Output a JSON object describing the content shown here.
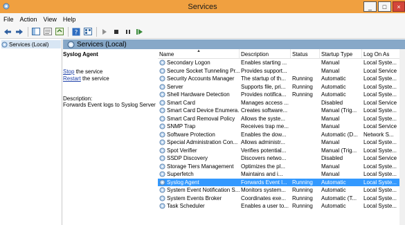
{
  "window": {
    "title": "Services",
    "minimize_label": "_",
    "maximize_label": "□",
    "close_label": "×"
  },
  "menu": [
    "File",
    "Action",
    "View",
    "Help"
  ],
  "toolbar_icons": [
    "back-icon",
    "forward-icon",
    "show-hide-tree-icon",
    "properties-icon",
    "refresh-icon",
    "help-icon",
    "view-icon",
    "start-icon",
    "stop-icon",
    "pause-icon",
    "restart-icon"
  ],
  "tree": {
    "root_label": "Services (Local)"
  },
  "pane": {
    "header_label": "Services (Local)",
    "selected_service": "Syslog Agent",
    "stop_link": "Stop",
    "stop_suffix": " the service",
    "restart_link": "Restart",
    "restart_suffix": " the service",
    "description_label": "Description:",
    "description_text": "Forwards Event logs to Syslog Server"
  },
  "table": {
    "columns": [
      "Name",
      "Description",
      "Status",
      "Startup Type",
      "Log On As"
    ],
    "rows": [
      {
        "name": "Secondary Logon",
        "description": "Enables starting ...",
        "status": "",
        "startup": "Manual",
        "logon": "Local Syste..."
      },
      {
        "name": "Secure Socket Tunneling Pr...",
        "description": "Provides support...",
        "status": "",
        "startup": "Manual",
        "logon": "Local Service"
      },
      {
        "name": "Security Accounts Manager",
        "description": "The startup of th...",
        "status": "Running",
        "startup": "Automatic",
        "logon": "Local Syste..."
      },
      {
        "name": "Server",
        "description": "Supports file, pri...",
        "status": "Running",
        "startup": "Automatic",
        "logon": "Local Syste..."
      },
      {
        "name": "Shell Hardware Detection",
        "description": "Provides notifica...",
        "status": "Running",
        "startup": "Automatic",
        "logon": "Local Syste..."
      },
      {
        "name": "Smart Card",
        "description": "Manages access ...",
        "status": "",
        "startup": "Disabled",
        "logon": "Local Service"
      },
      {
        "name": "Smart Card Device Enumera...",
        "description": "Creates software...",
        "status": "",
        "startup": "Manual (Trig...",
        "logon": "Local Syste..."
      },
      {
        "name": "Smart Card Removal Policy",
        "description": "Allows the syste...",
        "status": "",
        "startup": "Manual",
        "logon": "Local Syste..."
      },
      {
        "name": "SNMP Trap",
        "description": "Receives trap me...",
        "status": "",
        "startup": "Manual",
        "logon": "Local Service"
      },
      {
        "name": "Software Protection",
        "description": "Enables the dow...",
        "status": "",
        "startup": "Automatic (D...",
        "logon": "Network S..."
      },
      {
        "name": "Special Administration Con...",
        "description": "Allows administr...",
        "status": "",
        "startup": "Manual",
        "logon": "Local Syste..."
      },
      {
        "name": "Spot Verifier",
        "description": "Verifies potential...",
        "status": "",
        "startup": "Manual (Trig...",
        "logon": "Local Syste..."
      },
      {
        "name": "SSDP Discovery",
        "description": "Discovers netwo...",
        "status": "",
        "startup": "Disabled",
        "logon": "Local Service"
      },
      {
        "name": "Storage Tiers Management",
        "description": "Optimizes the pl...",
        "status": "",
        "startup": "Manual",
        "logon": "Local Syste..."
      },
      {
        "name": "Superfetch",
        "description": "Maintains and i...",
        "status": "",
        "startup": "Manual",
        "logon": "Local Syste..."
      },
      {
        "name": "Syslog Agent",
        "description": "Forwards Event l...",
        "status": "Running",
        "startup": "Automatic",
        "logon": "Local Syste...",
        "selected": true
      },
      {
        "name": "System Event Notification S...",
        "description": "Monitors system...",
        "status": "Running",
        "startup": "Automatic",
        "logon": "Local Syste..."
      },
      {
        "name": "System Events Broker",
        "description": "Coordinates exe...",
        "status": "Running",
        "startup": "Automatic (T...",
        "logon": "Local Syste..."
      },
      {
        "name": "Task Scheduler",
        "description": "Enables a user to...",
        "status": "Running",
        "startup": "Automatic",
        "logon": "Local Syste..."
      }
    ]
  },
  "colors": {
    "titlebar": "#f0a040",
    "selected_row": "#3399ff",
    "pane_header": "#87a8c8",
    "link": "#1c3fa8"
  }
}
